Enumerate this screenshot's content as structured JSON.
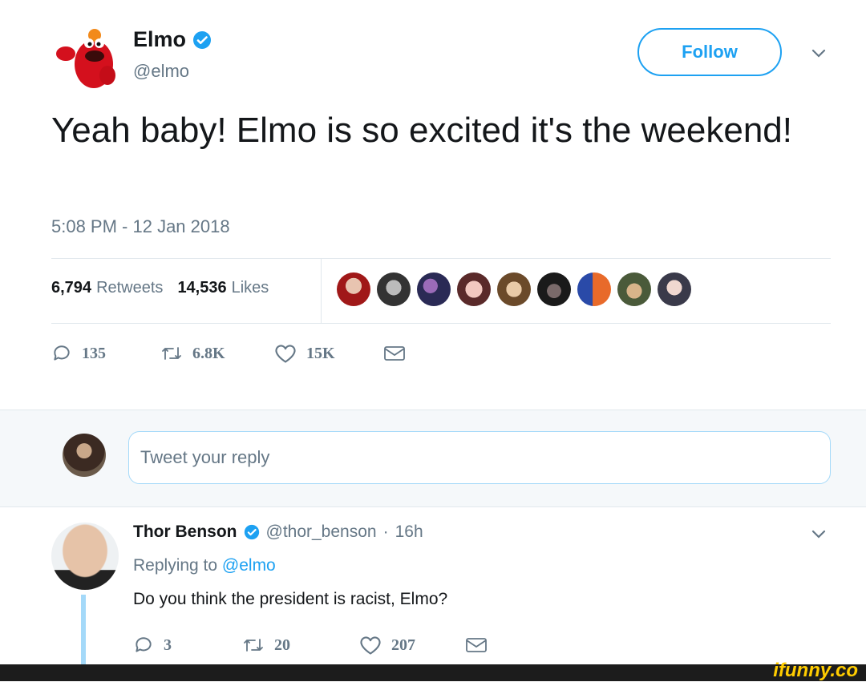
{
  "author": {
    "name": "Elmo",
    "handle": "@elmo",
    "verified": true,
    "avatar_icon": "elmo-avatar"
  },
  "follow_button": {
    "label": "Follow"
  },
  "tweet": {
    "text": "Yeah baby! Elmo is so excited it's the weekend!",
    "timestamp": "5:08 PM - 12 Jan 2018"
  },
  "stats": {
    "retweets_count": "6,794",
    "retweets_label": "Retweets",
    "likes_count": "14,536",
    "likes_label": "Likes",
    "liker_avatar_count": 9
  },
  "actions": {
    "reply_count": "135",
    "retweet_count": "6.8K",
    "like_count": "15K"
  },
  "reply_box": {
    "placeholder": "Tweet your reply"
  },
  "reply": {
    "name": "Thor Benson",
    "handle": "@thor_benson",
    "time": "16h",
    "replying_prefix": "Replying to",
    "replying_to": "@elmo",
    "text": "Do you think the president is racist, Elmo?",
    "reply_count": "3",
    "retweet_count": "20",
    "like_count": "207"
  },
  "watermark": "ifunny.co",
  "colors": {
    "accent": "#1da1f2",
    "muted": "#657786",
    "text": "#14171a",
    "divider": "#e1e8ed"
  }
}
